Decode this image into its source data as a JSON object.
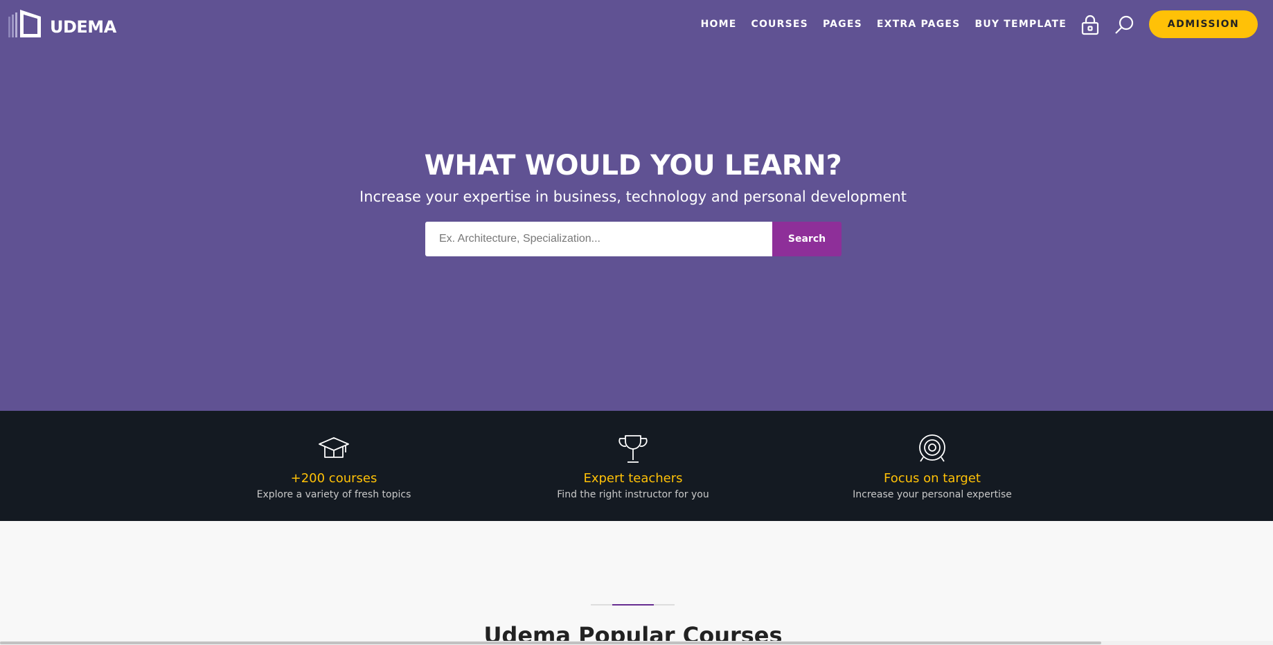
{
  "brand": {
    "name": "UDEMA"
  },
  "nav": {
    "items": [
      "HOME",
      "COURSES",
      "PAGES",
      "EXTRA PAGES",
      "BUY TEMPLATE"
    ]
  },
  "header": {
    "lock_icon": "lock-icon",
    "search_icon": "search-icon",
    "admission_label": "ADMISSION"
  },
  "hero": {
    "title": "WHAT WOULD YOU LEARN?",
    "subtitle": "Increase your expertise in business, technology and personal development",
    "search_placeholder": "Ex. Architecture, Specialization...",
    "search_button": "Search"
  },
  "features": [
    {
      "icon": "graduation-cap-icon",
      "title": "+200 courses",
      "desc": "Explore a variety of fresh topics"
    },
    {
      "icon": "trophy-icon",
      "title": "Expert teachers",
      "desc": "Find the right instructor for you"
    },
    {
      "icon": "target-icon",
      "title": "Focus on target",
      "desc": "Increase your personal expertise"
    }
  ],
  "section": {
    "title": "Udema Popular Courses"
  },
  "colors": {
    "hero_bg": "#605293",
    "accent": "#ffc107",
    "search_button": "#8e2f99",
    "features_bg": "#141a22"
  }
}
